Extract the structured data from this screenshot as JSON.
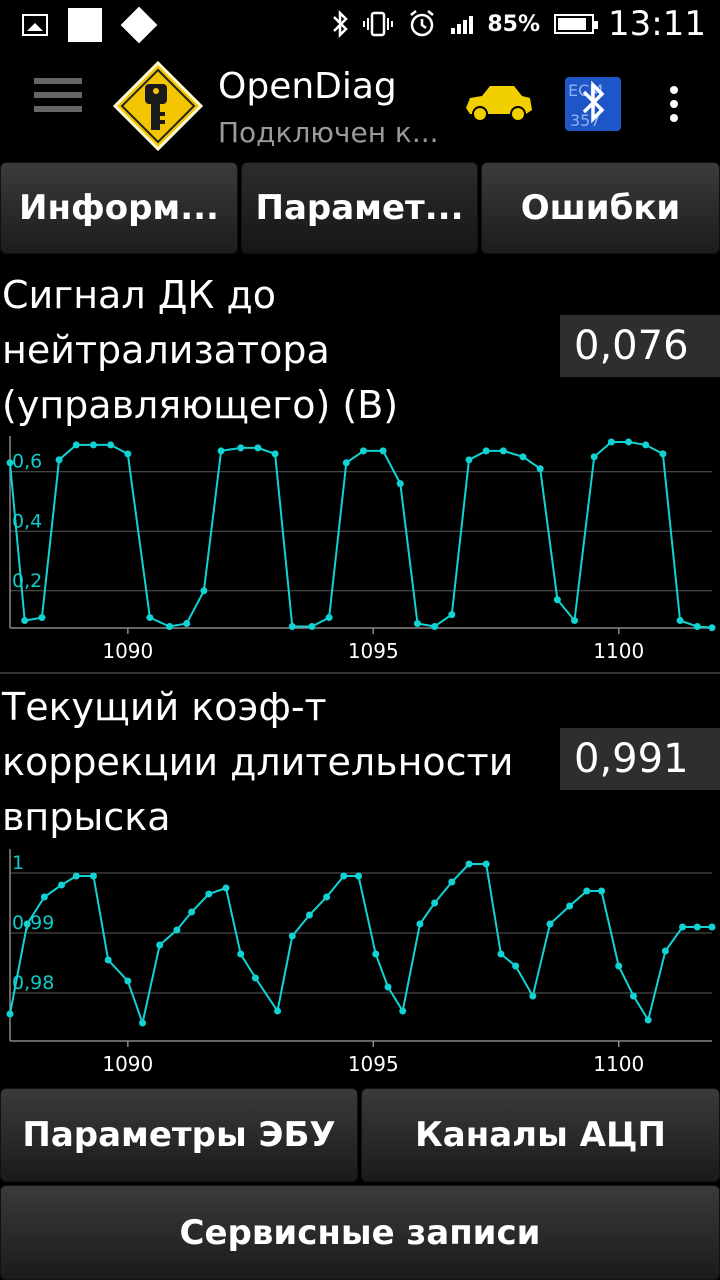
{
  "status_bar": {
    "battery": "85%",
    "time": "13:11",
    "icons": [
      "image-icon",
      "square-icon",
      "diamond-icon",
      "bluetooth-icon",
      "vibrate-icon",
      "alarm-icon",
      "signal-icon",
      "battery-icon"
    ]
  },
  "app_bar": {
    "title": "OpenDiag",
    "subtitle": "Подключен к...",
    "icons": [
      "menu-icon",
      "key-logo-icon",
      "car-icon",
      "bluetooth-ecu-icon",
      "more-icon"
    ],
    "accent": "#f2c500"
  },
  "tabs": [
    {
      "label": "Информ..."
    },
    {
      "label": "Парамет..."
    },
    {
      "label": "Ошибки"
    }
  ],
  "params": [
    {
      "title_lines": [
        "Сигнал ДК до",
        "нейтрализатора",
        "(управляющего) (В)"
      ],
      "value": "0,076",
      "chart_data": {
        "type": "line",
        "color": "#12d3d3",
        "x_ticks": [
          1090,
          1095,
          1100
        ],
        "y_ticks": [
          "0,2",
          "0,4",
          "0,6"
        ],
        "y_tick_values": [
          0.2,
          0.4,
          0.6
        ],
        "xlim": [
          1087.6,
          1101.9
        ],
        "ylim": [
          0.075,
          0.72
        ],
        "x": [
          1087.6,
          1087.9,
          1088.25,
          1088.6,
          1088.95,
          1089.3,
          1089.65,
          1090.0,
          1090.45,
          1090.85,
          1091.2,
          1091.55,
          1091.9,
          1092.3,
          1092.65,
          1093.0,
          1093.35,
          1093.75,
          1094.1,
          1094.45,
          1094.8,
          1095.2,
          1095.55,
          1095.9,
          1096.25,
          1096.6,
          1096.95,
          1097.3,
          1097.65,
          1098.05,
          1098.4,
          1098.75,
          1099.1,
          1099.5,
          1099.85,
          1100.2,
          1100.55,
          1100.9,
          1101.25,
          1101.6,
          1101.9
        ],
        "y": [
          0.63,
          0.1,
          0.11,
          0.64,
          0.69,
          0.69,
          0.69,
          0.66,
          0.11,
          0.08,
          0.09,
          0.2,
          0.67,
          0.68,
          0.68,
          0.66,
          0.08,
          0.08,
          0.11,
          0.63,
          0.67,
          0.67,
          0.56,
          0.09,
          0.08,
          0.12,
          0.64,
          0.67,
          0.67,
          0.65,
          0.61,
          0.17,
          0.1,
          0.65,
          0.7,
          0.7,
          0.69,
          0.66,
          0.1,
          0.08,
          0.076
        ]
      }
    },
    {
      "title_lines": [
        "Текущий коэф-т",
        "коррекции длительности",
        "впрыска"
      ],
      "value": "0,991",
      "chart_data": {
        "type": "line",
        "color": "#12d3d3",
        "x_ticks": [
          1090,
          1095,
          1100
        ],
        "y_ticks": [
          "0,98",
          "0,99",
          "1"
        ],
        "y_tick_values": [
          0.98,
          0.99,
          1.0
        ],
        "xlim": [
          1087.6,
          1101.9
        ],
        "ylim": [
          0.972,
          1.004
        ],
        "x": [
          1087.6,
          1087.95,
          1088.3,
          1088.65,
          1088.95,
          1089.3,
          1089.6,
          1090.0,
          1090.3,
          1090.65,
          1091.0,
          1091.3,
          1091.65,
          1092.0,
          1092.3,
          1092.6,
          1093.05,
          1093.35,
          1093.7,
          1094.05,
          1094.4,
          1094.7,
          1095.05,
          1095.3,
          1095.6,
          1095.95,
          1096.25,
          1096.6,
          1096.95,
          1097.3,
          1097.6,
          1097.9,
          1098.25,
          1098.6,
          1099.0,
          1099.35,
          1099.65,
          1100.0,
          1100.3,
          1100.6,
          1100.95,
          1101.3,
          1101.6,
          1101.9
        ],
        "y": [
          0.9765,
          0.9915,
          0.996,
          0.998,
          0.9995,
          0.9995,
          0.9855,
          0.982,
          0.975,
          0.988,
          0.9905,
          0.9935,
          0.9965,
          0.9975,
          0.9865,
          0.9825,
          0.977,
          0.9895,
          0.993,
          0.996,
          0.9995,
          0.9995,
          0.9865,
          0.981,
          0.977,
          0.9915,
          0.995,
          0.9985,
          1.0015,
          1.0015,
          0.9865,
          0.9845,
          0.9795,
          0.9915,
          0.9945,
          0.997,
          0.997,
          0.9845,
          0.9795,
          0.9755,
          0.987,
          0.991,
          0.991,
          0.991
        ]
      }
    }
  ],
  "bottom_buttons": {
    "ecu_params": "Параметры ЭБУ",
    "adc_channels": "Каналы АЦП",
    "service_records": "Сервисные записи"
  }
}
